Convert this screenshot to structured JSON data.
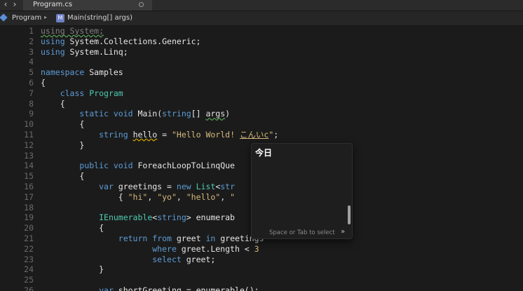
{
  "tabbar": {
    "back_icon": "‹",
    "forward_icon": "›",
    "tab_title": "Program.cs"
  },
  "breadcrumb": {
    "root": "Program",
    "separator": "▸",
    "method_icon_letter": "M",
    "method": "Main(string[] args)"
  },
  "editor": {
    "lines": [
      {
        "n": "1"
      },
      {
        "n": "2"
      },
      {
        "n": "3"
      },
      {
        "n": "4"
      },
      {
        "n": "5"
      },
      {
        "n": "6"
      },
      {
        "n": "7"
      },
      {
        "n": "8"
      },
      {
        "n": "9"
      },
      {
        "n": "10"
      },
      {
        "n": "11"
      },
      {
        "n": "12"
      },
      {
        "n": "13"
      },
      {
        "n": "14"
      },
      {
        "n": "15"
      },
      {
        "n": "16"
      },
      {
        "n": "17"
      },
      {
        "n": "18"
      },
      {
        "n": "19"
      },
      {
        "n": "20"
      },
      {
        "n": "21"
      },
      {
        "n": "22"
      },
      {
        "n": "23"
      },
      {
        "n": "24"
      },
      {
        "n": "25"
      },
      {
        "n": "26"
      }
    ]
  },
  "completion": {
    "candidate": "今日",
    "hint": "Space or Tab to select",
    "chevron": "»"
  },
  "colors": {
    "keyword": "#5d9cd6",
    "type": "#4ec9b0",
    "string": "#d7ba7d",
    "background": "#1b1b1b"
  }
}
